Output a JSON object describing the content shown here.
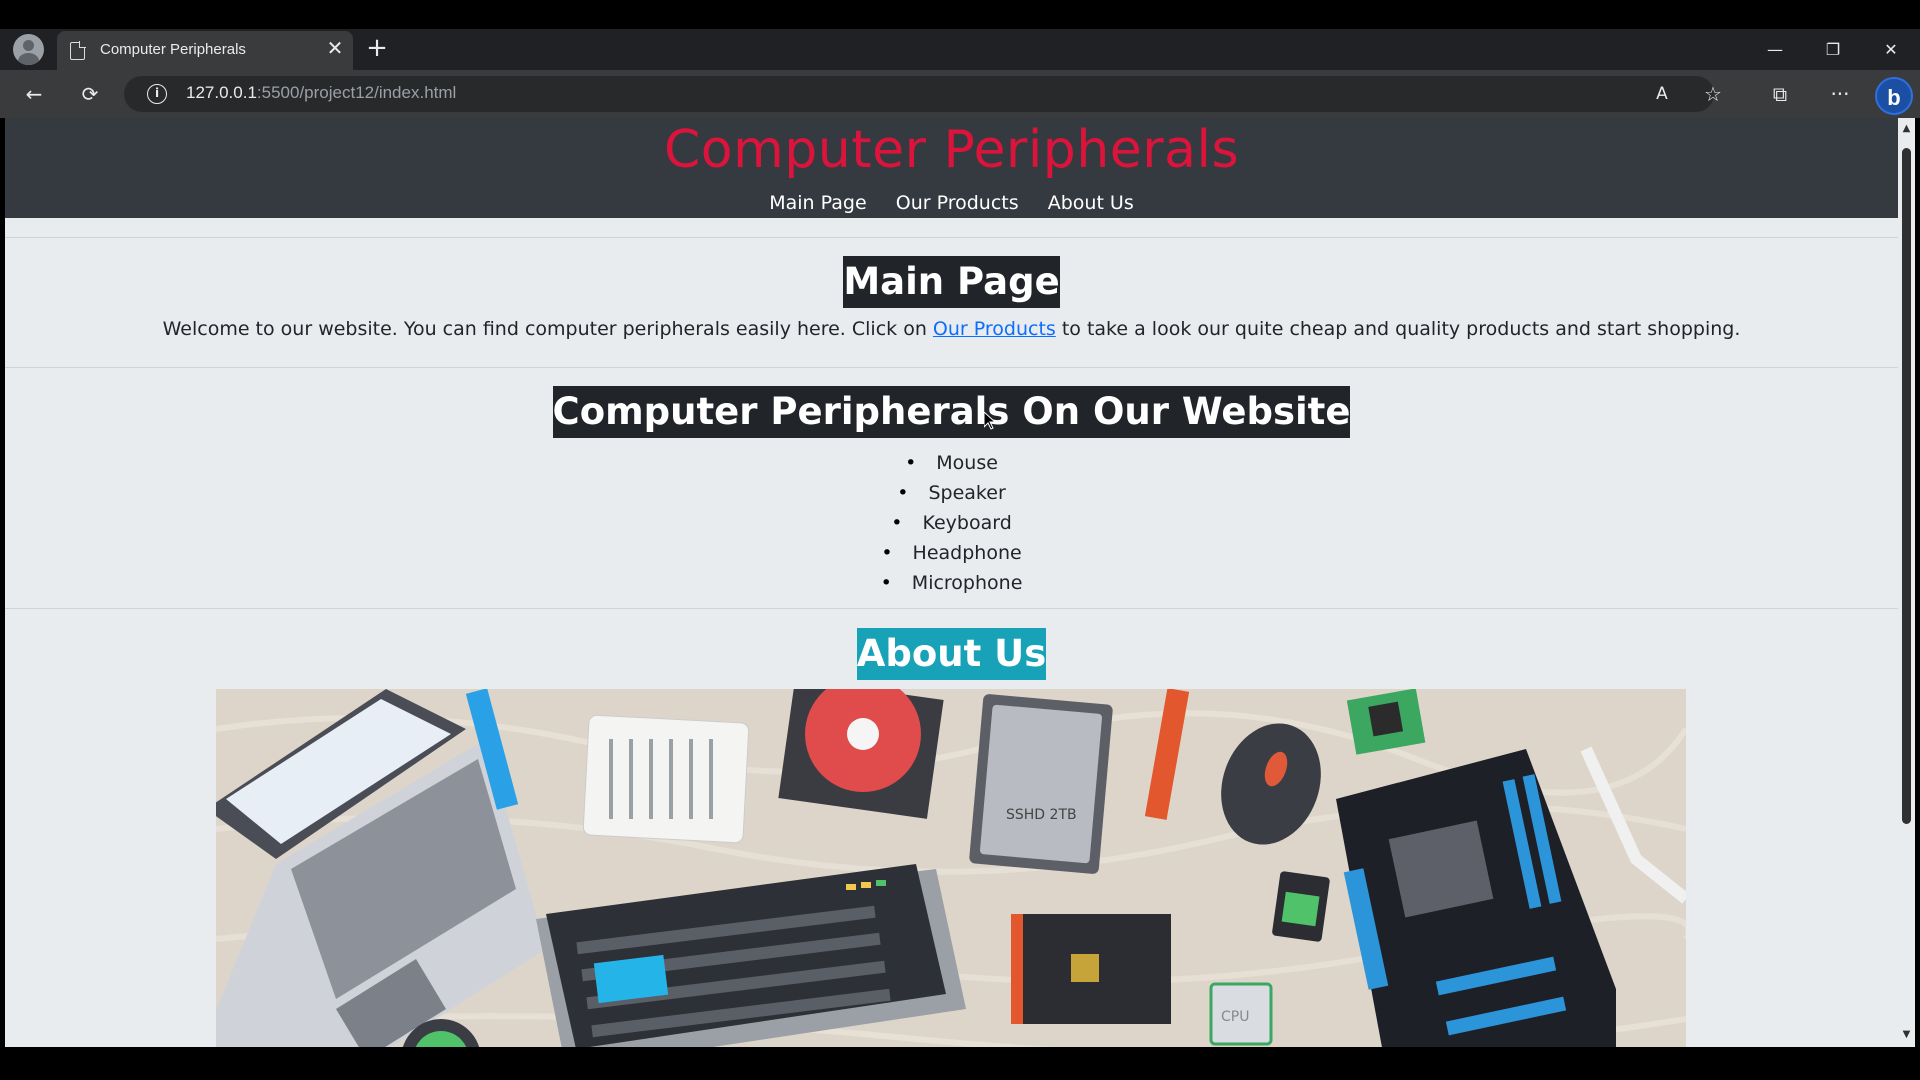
{
  "browser": {
    "tab_title": "Computer Peripherals",
    "tab_close": "✕",
    "new_tab": "+",
    "window_controls": {
      "minimize": "—",
      "restore": "❐",
      "close": "✕"
    },
    "url_host": "127.0.0.1",
    "url_path": ":5500/project12/index.html",
    "toolbar": {
      "back": "←",
      "reload": "⟳",
      "read_aloud": "A",
      "favorite": "☆",
      "extensions": "⧉",
      "more": "···",
      "copilot": "b"
    }
  },
  "site": {
    "title": "Computer Peripherals",
    "nav": [
      "Main Page",
      "Our Products",
      "About Us"
    ]
  },
  "main_section": {
    "heading": "Main Page",
    "text_before": "Welcome to our website. You can find computer peripherals easily here. Click on ",
    "link": "Our Products",
    "text_after": " to take a look our quite cheap and quality products and start shopping."
  },
  "products_section": {
    "heading": "Computer Peripherals On Our Website",
    "items": [
      "Mouse",
      "Speaker",
      "Keyboard",
      "Headphone",
      "Microphone"
    ]
  },
  "about_section": {
    "heading": "About Us",
    "image_label": "SSHD 2TB",
    "cpu_label": "CPU"
  },
  "colors": {
    "header_bg": "#343a40",
    "title_red": "#dc143c",
    "page_bg": "#e9ecef",
    "dark_heading_bg": "#212529",
    "teal_heading_bg": "#17a2b8",
    "link_blue": "#0d6efd"
  }
}
